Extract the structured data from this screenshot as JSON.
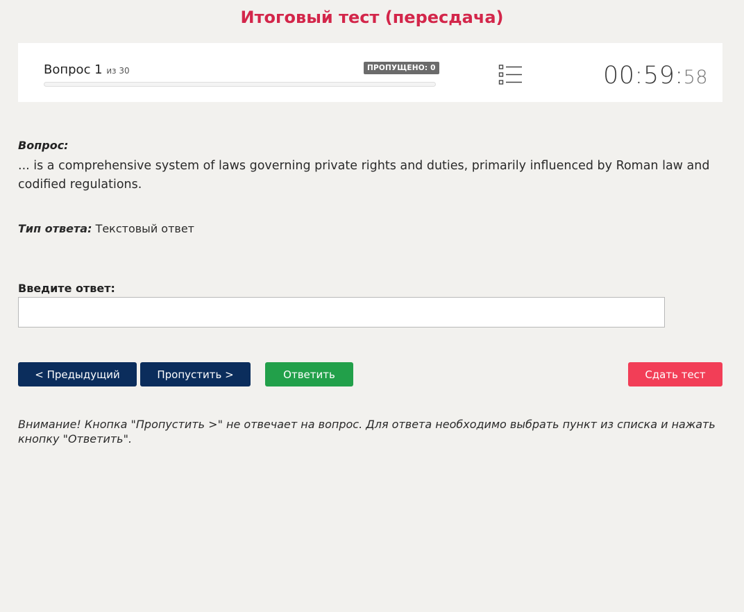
{
  "header": {
    "title": "Итоговый тест (пересдача)"
  },
  "status": {
    "question_label": "Вопрос 1",
    "question_total": "из 30",
    "skipped_badge": "ПРОПУЩЕНО: 0",
    "progress_fraction": 0.0,
    "questions_list_icon": "list-icon",
    "timer_main": "00:59:",
    "timer_seconds": "58"
  },
  "question": {
    "label": "Вопрос:",
    "text": "... is a comprehensive system of laws governing private rights and duties, primarily influenced by Roman law and codified regulations."
  },
  "answer_type": {
    "label": "Тип ответа:",
    "value": "Текстовый ответ"
  },
  "answer": {
    "label": "Введите ответ:",
    "value": "",
    "placeholder": ""
  },
  "buttons": {
    "prev": "< Предыдущий",
    "skip": "Пропустить >",
    "answer": "Ответить",
    "submit": "Сдать тест"
  },
  "notice": "Внимание! Кнопка \"Пропустить >\" не отвечает на вопрос. Для ответа необходимо выбрать пункт из списка и нажать кнопку \"Ответить\".",
  "colors": {
    "title": "#d3264a",
    "primary": "#0b2d5c",
    "answer_button": "#22a04a",
    "submit_button": "#f23e57",
    "background": "#f2f1ee"
  }
}
